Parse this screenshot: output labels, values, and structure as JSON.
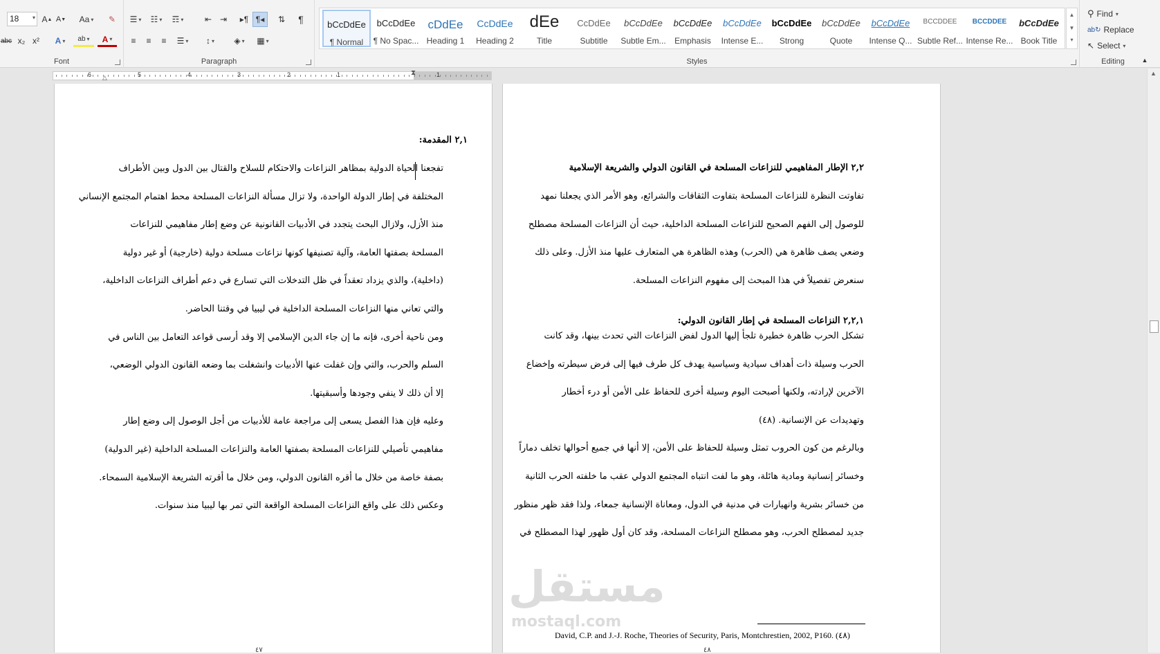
{
  "ribbon": {
    "font_group": {
      "label": "Font",
      "font_size": "18",
      "grow_label": "A",
      "shrink_label": "A",
      "case_label": "Aa",
      "strike_label": "abc",
      "sub_label": "x₂",
      "sup_label": "x²",
      "effects_label": "A",
      "highlight_label": "ab",
      "color_label": "A"
    },
    "paragraph_group": {
      "label": "Paragraph"
    },
    "styles_group": {
      "label": "Styles",
      "items": [
        {
          "preview": "bCcDdEe",
          "name": "¶ Normal"
        },
        {
          "preview": "bCcDdEe",
          "name": "¶ No Spac..."
        },
        {
          "preview": "cDdEe",
          "name": "Heading 1"
        },
        {
          "preview": "CcDdEe",
          "name": "Heading 2"
        },
        {
          "preview": "dEe",
          "name": "Title"
        },
        {
          "preview": "CcDdEe",
          "name": "Subtitle"
        },
        {
          "preview": "bCcDdEe",
          "name": "Subtle Em..."
        },
        {
          "preview": "bCcDdEe",
          "name": "Emphasis"
        },
        {
          "preview": "bCcDdEe",
          "name": "Intense E..."
        },
        {
          "preview": "bCcDdEe",
          "name": "Strong"
        },
        {
          "preview": "bCcDdEe",
          "name": "Quote"
        },
        {
          "preview": "bCcDdEe",
          "name": "Intense Q..."
        },
        {
          "preview": "BCCDDEE",
          "name": "Subtle Ref..."
        },
        {
          "preview": "BCCDDEE",
          "name": "Intense Re..."
        },
        {
          "preview": "bCcDdEe",
          "name": "Book Title"
        }
      ]
    },
    "editing_group": {
      "label": "Editing",
      "find": "Find",
      "replace": "Replace",
      "select": "Select"
    },
    "accent_color": "#2b579a"
  },
  "ruler": {
    "numbers": [
      "6",
      "5",
      "4",
      "3",
      "2",
      "1",
      "1"
    ]
  },
  "left_page": {
    "heading": "٢,١ المقدمة:",
    "lines": [
      "تفجعنا الحياة الدولية بمظاهر النزاعات والاحتكام للسلاح والقتال بين الدول وبين الأطراف",
      "المختلفة في إطار الدولة الواحدة، ولا تزال مسألة النزاعات المسلحة محط اهتمام المجتمع الإنساني",
      "منذ الأزل، ولازال البحث يتجدد في الأدبيات القانونية عن وضع إطار مفاهيمي للنزاعات",
      "المسلحة بصفتها العامة، وآلية تصنيفها كونها نزاعات مسلحة دولية (خارجية) أو غير دولية",
      "(داخلية)، والذي يزداد تعقداً في ظل التدخلات التي تسارع في دعم أطراف النزاعات الداخلية،",
      "والتي تعاني منها النزاعات المسلحة الداخلية في ليبيا في وقتنا الحاضر.",
      "ومن ناحية أخرى، فإنه ما إن جاء الدين الإسلامي إلا وقد أرسى قواعد التعامل بين الناس في",
      "السلم والحرب، والتي وإن غفلت عنها الأدبيات وانشغلت بما وضعه القانون الدولي الوضعي،",
      "إلا أن ذلك لا ينفي وجودها وأسبقيتها.",
      "وعليه فإن هذا الفصل يسعى إلى مراجعة عامة للأدبيات من أجل الوصول إلى وضع إطار",
      "مفاهيمي تأصيلي للنزاعات المسلحة بصفتها العامة والنزاعات المسلحة الداخلية (غير الدولية)",
      "بصفة خاصة من خلال ما أقره القانون الدولي، ومن خلال ما أقرته الشريعة الإسلامية السمحاء.",
      "وعكس ذلك على واقع النزاعات المسلحة الواقعة التي تمر بها ليبيا منذ سنوات."
    ],
    "page_number": "٤٧"
  },
  "right_page": {
    "heading": "٢,٢ الإطار المفاهيمي للنزاعات المسلحة في القانون الدولي والشريعة الإسلامية",
    "lines_a": [
      "تفاوتت النظرة للنزاعات المسلحة بتفاوت الثقافات والشرائع، وهو الأمر الذي يجعلنا نمهد",
      "للوصول إلى الفهم الصحيح للنزاعات المسلحة الداخلية، حيث أن النزاعات المسلحة مصطلح",
      "وضعي يصف ظاهرة هي (الحرب) وهذه الظاهرة هي المتعارف عليها منذ الأزل. وعلى ذلك",
      "سنعرض تفصيلاً في هذا المبحث إلى مفهوم النزاعات المسلحة."
    ],
    "subheading": "٢,٢,١ النزاعات المسلحة في إطار القانون الدولي:",
    "lines_b": [
      "تشكل الحرب ظاهرة خطيرة تلجأ إليها الدول لفض النزاعات التي تحدث بينها، وقد كانت",
      "الحرب وسيلة ذات أهداف سيادية وسياسية يهدف كل طرف فيها إلى فرض سيطرته وإخضاع",
      "الآخرين لإرادته، ولكنها أصبحت اليوم وسيلة أخرى للحفاظ على الأمن أو درء أخطار",
      "وتهديدات عن الإنسانية. (٤٨)",
      "وبالرغم من كون الحروب تمثل وسيلة للحفاظ على الأمن، إلا أنها في جميع أحوالها تخلف دماراً",
      "وخسائر إنسانية ومادية هائلة، وهو ما لفت انتباه المجتمع الدولي عقب ما خلفته الحرب الثانية",
      "من خسائر بشرية وانهيارات في مدنية في الدول، ومعاناة الإنسانية جمعاء، ولذا فقد ظهر منظور",
      "جديد لمصطلح الحرب، وهو مصطلح النزاعات المسلحة، وقد كان أول ظهور لهذا المصطلح في"
    ],
    "footnote": "David, C.P. and J.-J. Roche, Theories of Security, Paris, Montchrestien, 2002, P160. (٤٨)",
    "page_number": "٤٨"
  },
  "watermark": {
    "arabic": "مستقل",
    "latin": "mostaql.com"
  }
}
